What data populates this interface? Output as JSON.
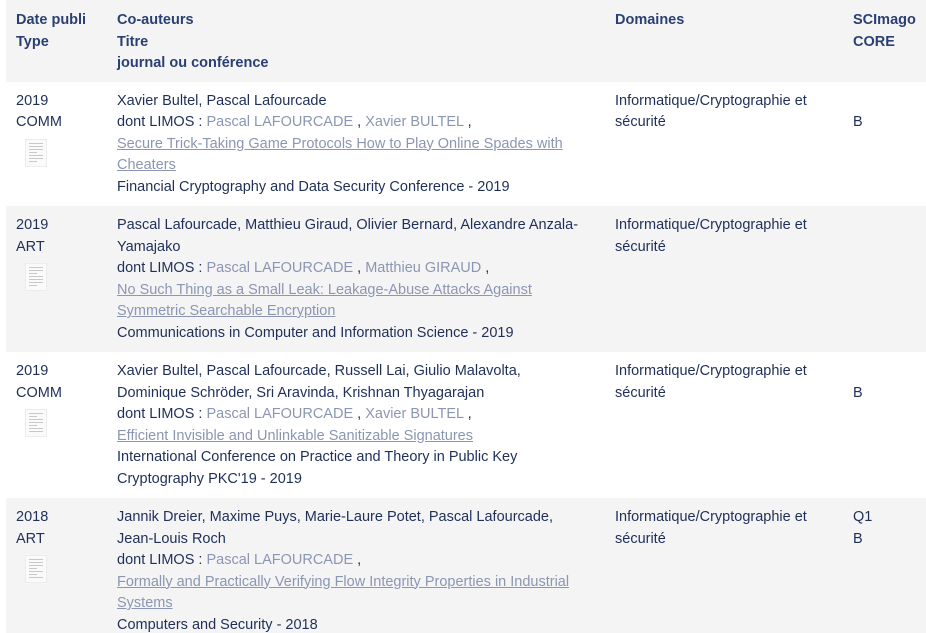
{
  "header": {
    "col1_line1": "Date publi",
    "col1_line2": "Type",
    "col2_line1": "Co-auteurs",
    "col2_line2": "Titre",
    "col2_line3": "journal ou conférence",
    "col3": "Domaines",
    "col4_line1": "SCImago",
    "col4_line2": "CORE"
  },
  "publications": [
    {
      "year": "2019",
      "type": "COMM",
      "coauthors": "Xavier Bultel, Pascal Lafourcade",
      "limos_label": "dont LIMOS :",
      "limos_authors": [
        "Pascal LAFOURCADE",
        "Xavier BULTEL"
      ],
      "title_line1": "Secure Trick-Taking Game Protocols How to Play Online Spades with",
      "title_line2": "Cheaters",
      "venue": "Financial Cryptography and Data Security Conference - 2019",
      "domain": "Informatique/Cryptographie et sécurité",
      "scimago": "",
      "core": "B"
    },
    {
      "year": "2019",
      "type": "ART",
      "coauthors_line1": "Pascal Lafourcade, Matthieu Giraud, Olivier Bernard, Alexandre Anzala-",
      "coauthors_line2": "Yamajako",
      "limos_label": "dont LIMOS :",
      "limos_authors": [
        "Pascal LAFOURCADE",
        "Matthieu GIRAUD"
      ],
      "title_line1": "No Such Thing as a Small Leak: Leakage-Abuse Attacks Against",
      "title_line2": "Symmetric Searchable Encryption",
      "venue": "Communications in Computer and Information Science - 2019",
      "domain": "Informatique/Cryptographie et sécurité",
      "scimago": "",
      "core": ""
    },
    {
      "year": "2019",
      "type": "COMM",
      "coauthors_line1": "Xavier Bultel, Pascal Lafourcade, Russell Lai, Giulio Malavolta,",
      "coauthors_line2": "Dominique Schröder, Sri Aravinda, Krishnan Thyagarajan",
      "limos_label": "dont LIMOS :",
      "limos_authors": [
        "Pascal LAFOURCADE",
        "Xavier BULTEL"
      ],
      "title_line1": "Efficient Invisible and Unlinkable Sanitizable Signatures",
      "venue_line1": "International Conference on Practice and Theory in Public Key",
      "venue_line2": "Cryptography PKC'19 - 2019",
      "domain": "Informatique/Cryptographie et sécurité",
      "scimago": "",
      "core": "B"
    },
    {
      "year": "2018",
      "type": "ART",
      "coauthors_line1": "Jannik Dreier, Maxime Puys, Marie-Laure Potet, Pascal Lafourcade,",
      "coauthors_line2": "Jean-Louis Roch",
      "limos_label": "dont LIMOS :",
      "limos_authors": [
        "Pascal LAFOURCADE"
      ],
      "title_line1": "Formally and Practically Verifying Flow Integrity Properties in Industrial",
      "title_line2": "Systems",
      "venue": "Computers and Security - 2018",
      "domain": "Informatique/Cryptographie et sécurité",
      "scimago": "Q1",
      "core": "B"
    }
  ]
}
